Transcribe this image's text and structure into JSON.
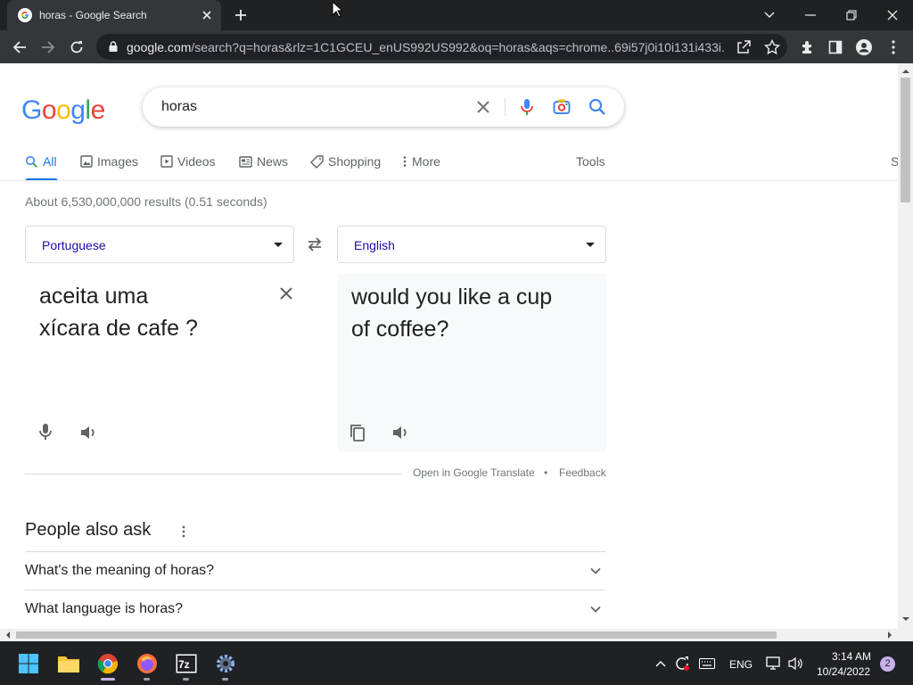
{
  "browser": {
    "tab_title": "horas - Google Search",
    "url_host": "google.com",
    "url_path": "/search?q=horas&rlz=1C1GCEU_enUS992US992&oq=horas&aqs=chrome..69i57j0i10i131i433i..."
  },
  "search": {
    "query": "horas",
    "logo_letters": [
      "G",
      "o",
      "o",
      "g",
      "l",
      "e"
    ],
    "logo_colors": [
      "#4285f4",
      "#ea4335",
      "#fbbc05",
      "#4285f4",
      "#34a853",
      "#ea4335"
    ]
  },
  "tabs": {
    "all": "All",
    "images": "Images",
    "videos": "Videos",
    "news": "News",
    "shopping": "Shopping",
    "more": "More",
    "tools": "Tools",
    "safesearch_partial": "S"
  },
  "results": {
    "stats": "About 6,530,000,000 results (0.51 seconds)"
  },
  "translate": {
    "source_lang": "Portuguese",
    "target_lang": "English",
    "source_line1": "aceita uma",
    "source_line2": "xícara de cafe ?",
    "target_line1": "would you like a cup",
    "target_line2": "of coffee?",
    "open_link": "Open in Google Translate",
    "bullet": "•",
    "feedback": "Feedback"
  },
  "people_also_ask": {
    "title": "People also ask",
    "questions": [
      "What's the meaning of horas?",
      "What language is horas?"
    ]
  },
  "taskbar": {
    "language": "ENG",
    "time": "3:14 AM",
    "date": "10/24/2022",
    "notification_count": "2"
  },
  "colors": {
    "accent": "#1a73e8",
    "link": "#1a0dab",
    "chrome_dark": "#202124",
    "chrome_toolbar": "#35363a"
  }
}
